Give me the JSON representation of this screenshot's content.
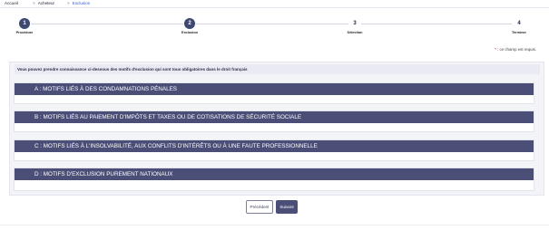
{
  "breadcrumb": {
    "items": [
      {
        "label": "Accueil",
        "sep": ""
      },
      {
        "label": "Acheteur",
        "sep": ">"
      },
      {
        "label": "Exclusion",
        "sep": ">"
      }
    ]
  },
  "stepper": {
    "steps": [
      {
        "number": "1",
        "label": "Procédure"
      },
      {
        "number": "2",
        "label": "Exclusion"
      },
      {
        "number": "3",
        "label": "Sélection"
      },
      {
        "number": "4",
        "label": "Terminer"
      }
    ]
  },
  "required_note": {
    "star": "*",
    "text": " : ce champ est requis."
  },
  "intro_text": "Vous pouvez prendre connaissance ci-dessous des motifs d'exclusion qui sont tous obligatoires dans le droit français",
  "sections": [
    {
      "title": "A : MOTIFS LIÉS À DES CONDAMNATIONS PÉNALES"
    },
    {
      "title": "B : MOTIFS LIÉS AU PAIEMENT D'IMPÔTS ET TAXES OU DE COTISATIONS DE SÉCURITÉ SOCIALE"
    },
    {
      "title": "C : MOTIFS LIÉS À L'INSOLVABILITÉ, AUX CONFLITS D'INTÉRÊTS OU À UNE FAUTE PROFESSIONNELLE"
    },
    {
      "title": "D : MOTIFS D'EXCLUSION PUREMENT NATIONAUX"
    }
  ],
  "buttons": {
    "previous": "Précédent",
    "next": "Suivant"
  }
}
